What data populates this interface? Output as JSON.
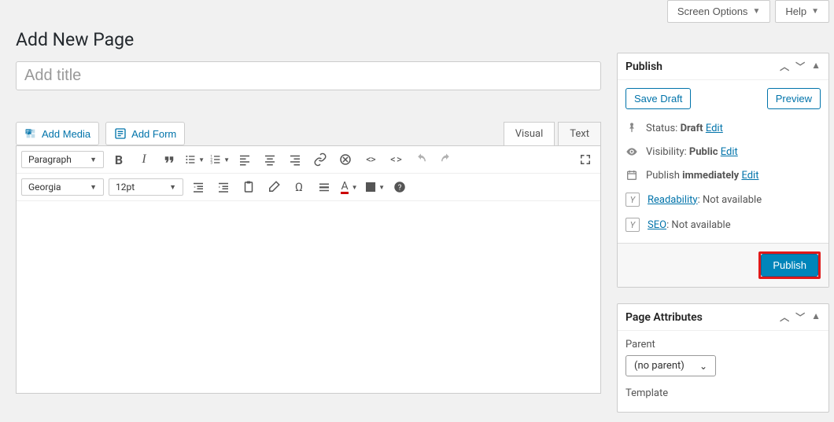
{
  "topbar": {
    "screen_options": "Screen Options",
    "help": "Help"
  },
  "page_title": "Add New Page",
  "title_placeholder": "Add title",
  "media": {
    "add_media": "Add Media",
    "add_form": "Add Form"
  },
  "tabs": {
    "visual": "Visual",
    "text": "Text",
    "active": "visual"
  },
  "toolbar": {
    "format": "Paragraph",
    "font": "Georgia",
    "size": "12pt"
  },
  "sidebar": {
    "publish": {
      "title": "Publish",
      "save_draft": "Save Draft",
      "preview": "Preview",
      "status_label": "Status:",
      "status_value": "Draft",
      "edit": "Edit",
      "visibility_label": "Visibility:",
      "visibility_value": "Public",
      "publish_time_label": "Publish",
      "publish_time_value": "immediately",
      "readability_label": "Readability",
      "readability_val": ": Not available",
      "seo_label": "SEO",
      "seo_val": ": Not available",
      "publish_btn": "Publish"
    },
    "attributes": {
      "title": "Page Attributes",
      "parent_label": "Parent",
      "parent_value": "(no parent)",
      "template_label": "Template"
    }
  }
}
